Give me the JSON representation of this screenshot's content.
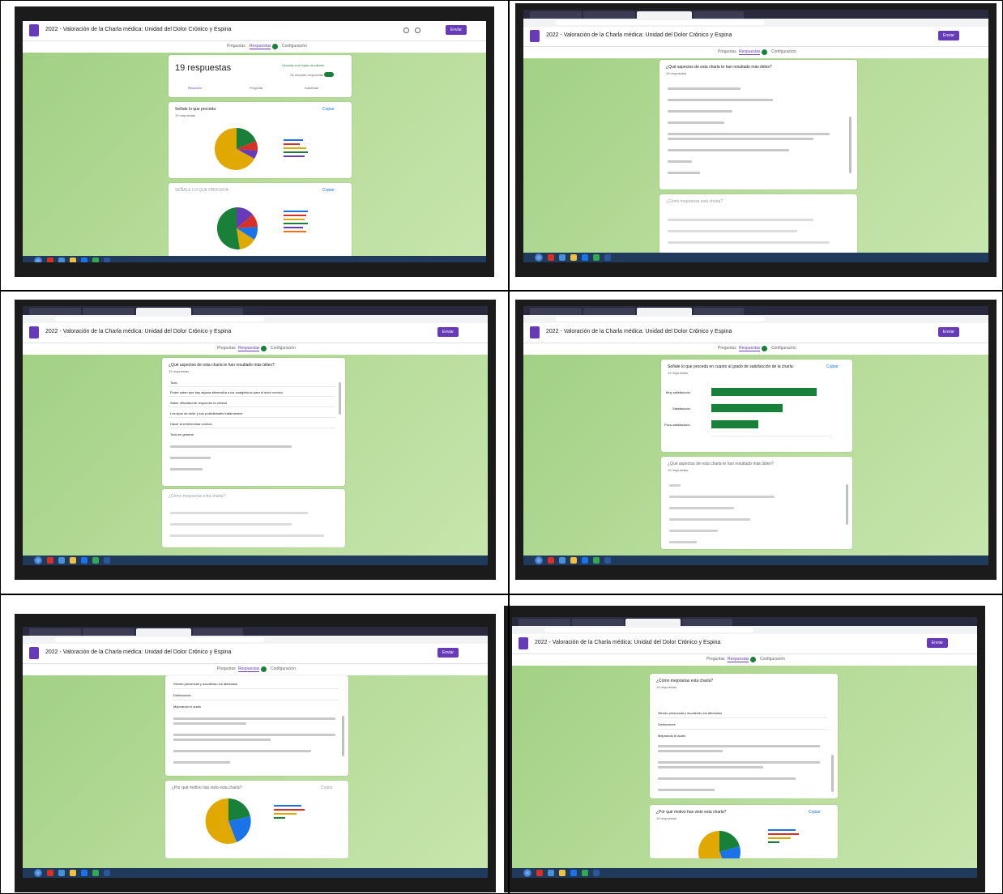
{
  "form": {
    "title": "2022 - Valoración de la Charla médica: Unidad del Dolor Crónico y Espina",
    "send_label": "Enviar"
  },
  "nav": {
    "questions": "Preguntas",
    "responses": "Respuestas",
    "settings": "Configuración",
    "badge": "19"
  },
  "summary": {
    "responses_count": "19 respuestas",
    "sheets_link": "Vincular con Hojas de cálculo",
    "accepting": "Se aceptan respuestas",
    "tabs": [
      "Resumen",
      "Pregunta",
      "Individual"
    ]
  },
  "questions": {
    "q_origin": "Señale lo que proceda",
    "q_origin_upper": "SEÑALE LO QUE PROCEDA",
    "q_satisfaction": "Señale lo que proceda en cuanto al grado de satisfacción de la charla:",
    "q_useful": "¿Qué aspectos de esta charla te han resultado más útiles?",
    "q_improve": "¿Cómo mejorarías esta charla?",
    "q_reason": "¿Por qué motivo has visto esta charla?",
    "responses_19": "19 respuestas",
    "copy": "Copiar"
  },
  "satisfaction_labels": [
    "Muy satisfactorio",
    "Satisfactorio",
    "Poco satisfactorio"
  ],
  "useful_answers": [
    "Todo",
    "Poder saber que hay alguna alternativa a los analgésicos para el dolor crónico",
    "Saber dificultad de responder la verdad",
    "Los tipos de dolor y sus posibilidades tratamientos",
    "Hacer la enfermedad crónica",
    "Todo en general"
  ],
  "improve_answers": [
    "Siendo presencial y acudiendo los afectados",
    "Distinciones",
    "Mejorando el audio"
  ],
  "colors": {
    "green": "#188038",
    "purple": "#673ab7",
    "gold": "#e0a800",
    "blue": "#1a73e8",
    "red": "#d93025"
  },
  "icons": [
    "form-icon",
    "star-icon",
    "palette-icon",
    "eye-icon",
    "undo-icon",
    "redo-icon",
    "more-icon",
    "copy-icon",
    "windows-start-icon"
  ]
}
